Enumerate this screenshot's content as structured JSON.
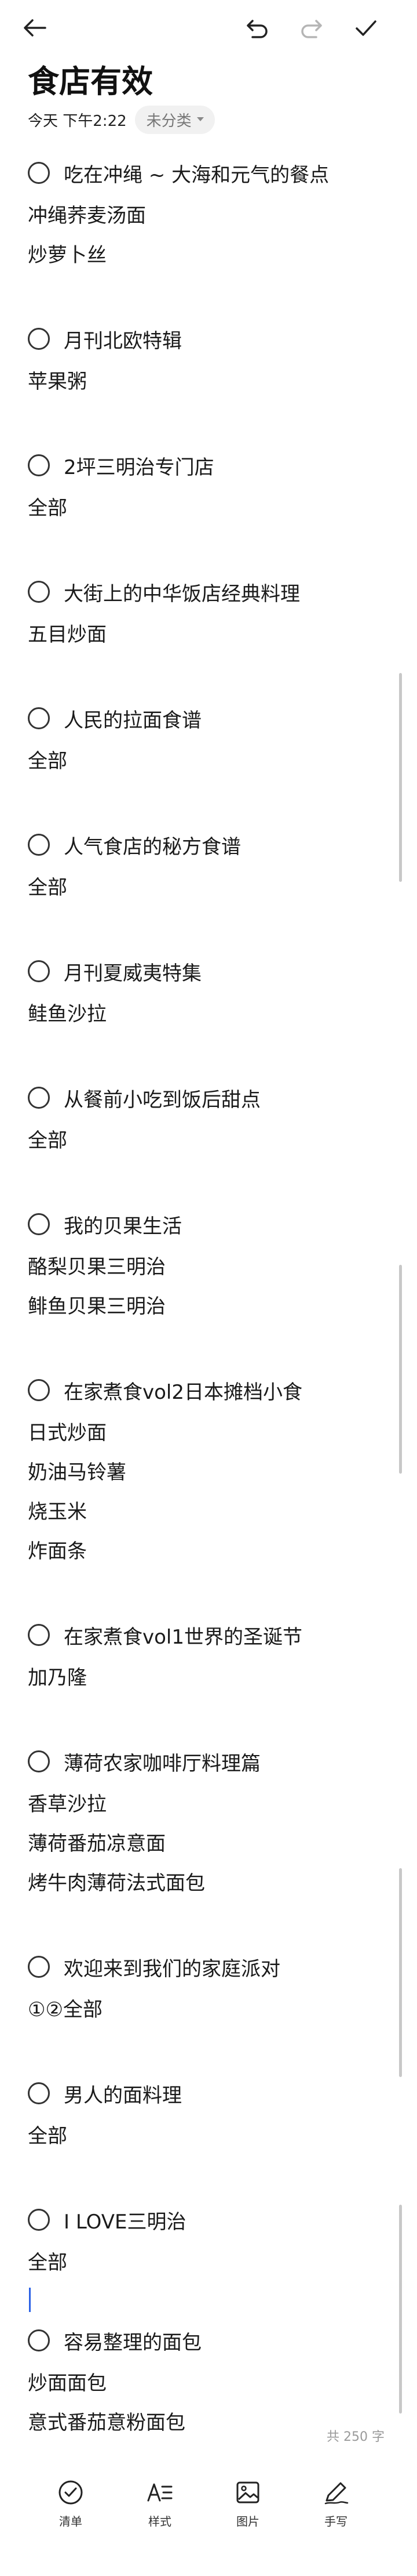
{
  "note": {
    "title": "食店有效",
    "date": "今天 下午2:22",
    "category": "未分类"
  },
  "items": [
    {
      "heading": "吃在冲绳 ~ 大海和元气的餐点",
      "lines": [
        "冲绳荞麦汤面",
        "炒萝卜丝"
      ]
    },
    {
      "heading": "月刊北欧特辑",
      "lines": [
        "苹果粥"
      ]
    },
    {
      "heading": "2坪三明治专门店",
      "lines": [
        "全部"
      ]
    },
    {
      "heading": "大街上的中华饭店经典料理",
      "lines": [
        "五目炒面"
      ]
    },
    {
      "heading": "人民的拉面食谱",
      "lines": [
        "全部"
      ]
    },
    {
      "heading": "人气食店的秘方食谱",
      "lines": [
        "全部"
      ]
    },
    {
      "heading": "月刊夏威夷特集",
      "lines": [
        "鲑鱼沙拉"
      ]
    },
    {
      "heading": "从餐前小吃到饭后甜点",
      "lines": [
        "全部"
      ]
    },
    {
      "heading": "我的贝果生活",
      "lines": [
        "酪梨贝果三明治",
        "鲱鱼贝果三明治"
      ]
    },
    {
      "heading": "在家煮食vol2日本摊档小食",
      "lines": [
        "日式炒面",
        "奶油马铃薯",
        "烧玉米",
        "炸面条"
      ]
    },
    {
      "heading": "在家煮食vol1世界的圣诞节",
      "lines": [
        "加乃隆"
      ]
    },
    {
      "heading": "薄荷农家咖啡厅料理篇",
      "lines": [
        "香草沙拉",
        "薄荷番茄凉意面",
        "烤牛肉薄荷法式面包"
      ]
    },
    {
      "heading": "欢迎来到我们的家庭派对",
      "lines": [
        "①②全部"
      ]
    },
    {
      "heading": "男人的面料理",
      "lines": [
        "全部"
      ]
    },
    {
      "heading": "I LOVE三明治",
      "lines": [
        "全部"
      ]
    },
    {
      "heading": "容易整理的面包",
      "lines": [
        "炒面面包",
        "意式番茄意粉面包"
      ]
    }
  ],
  "footer": {
    "word_count": "共 250 字"
  },
  "toolbar": {
    "checklist_label": "清单",
    "style_label": "样式",
    "image_label": "图片",
    "handwriting_label": "手写"
  },
  "icons": {
    "back": "back-arrow-icon",
    "undo": "undo-icon",
    "redo": "redo-icon",
    "done": "checkmark-icon",
    "checklist": "checklist-icon",
    "style": "text-style-icon",
    "image": "image-icon",
    "handwriting": "pen-icon"
  },
  "colors": {
    "cursor": "#2b62e6",
    "redo_disabled": "#b5b5b5"
  }
}
